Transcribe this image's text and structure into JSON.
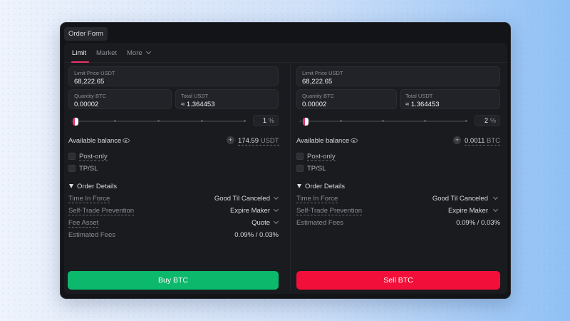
{
  "window": {
    "title": "Order Form"
  },
  "tabs": [
    {
      "label": "Limit",
      "active": true
    },
    {
      "label": "Market",
      "active": false
    },
    {
      "label": "More",
      "active": false
    }
  ],
  "buy": {
    "limit_price_label": "Limit Price USDT",
    "limit_price_value": "68,222.65",
    "quantity_label": "Quantity BTC",
    "quantity_value": "0.00002",
    "total_label": "Total USDT",
    "total_value": "≈ 1.364453",
    "slider_percent": 1,
    "percent_value": "1",
    "percent_unit": "%",
    "available_label": "Available balance",
    "balance_value": "174.59",
    "balance_unit": "USDT",
    "post_only": "Post-only",
    "tpsl": "TP/SL",
    "order_details": "Order Details",
    "time_in_force_label": "Time In Force",
    "time_in_force_value": "Good Til Canceled",
    "stp_label": "Self-Trade Prevention",
    "stp_value": "Expire Maker",
    "fee_asset_label": "Fee Asset",
    "fee_asset_value": "Quote",
    "est_fees_label": "Estimated Fees",
    "est_fees_value": "0.09% / 0.03%",
    "button_label": "Buy BTC",
    "button_color": "#0cb86b"
  },
  "sell": {
    "limit_price_label": "Limit Price USDT",
    "limit_price_value": "68,222.65",
    "quantity_label": "Quantity BTC",
    "quantity_value": "0.00002",
    "total_label": "Total USDT",
    "total_value": "≈ 1.364453",
    "slider_percent": 2,
    "percent_value": "2",
    "percent_unit": "%",
    "available_label": "Available balance",
    "balance_value": "0.0011",
    "balance_unit": "BTC",
    "post_only": "Post-only",
    "tpsl": "TP/SL",
    "order_details": "Order Details",
    "time_in_force_label": "Time In Force",
    "time_in_force_value": "Good Til Canceled",
    "stp_label": "Self-Trade Prevention",
    "stp_value": "Expire Maker",
    "est_fees_label": "Estimated Fees",
    "est_fees_value": "0.09% / 0.03%",
    "button_label": "Sell BTC",
    "button_color": "#f2103a"
  },
  "colors": {
    "accent": "#e8336a",
    "buy": "#0cb86b",
    "sell": "#f2103a"
  }
}
